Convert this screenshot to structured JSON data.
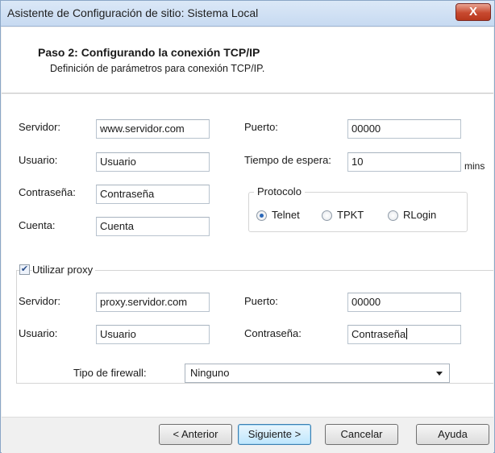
{
  "window": {
    "title": "Asistente de Configuración de sitio: Sistema Local",
    "close_label": "X"
  },
  "header": {
    "title": "Paso 2: Configurando la conexión TCP/IP",
    "subtitle": "Definición de parámetros para conexión TCP/IP."
  },
  "connection": {
    "server_label": "Servidor:",
    "server_value": "www.servidor.com",
    "user_label": "Usuario:",
    "user_value": "Usuario",
    "password_label": "Contraseña:",
    "password_value": "Contraseña",
    "account_label": "Cuenta:",
    "account_value": "Cuenta",
    "port_label": "Puerto:",
    "port_value": "00000",
    "timeout_label": "Tiempo de espera:",
    "timeout_value": "10",
    "timeout_unit": "mins"
  },
  "protocol": {
    "legend": "Protocolo",
    "options": [
      {
        "label": "Telnet",
        "selected": true
      },
      {
        "label": "TPKT",
        "selected": false
      },
      {
        "label": "RLogin",
        "selected": false
      }
    ]
  },
  "proxy": {
    "use_proxy_label": "Utilizar proxy",
    "use_proxy_checked": true,
    "server_label": "Servidor:",
    "server_value": "proxy.servidor.com",
    "user_label": "Usuario:",
    "user_value": "Usuario",
    "port_label": "Puerto:",
    "port_value": "00000",
    "password_label": "Contraseña:",
    "password_value": "Contraseña",
    "firewall_label": "Tipo de firewall:",
    "firewall_value": "Ninguno"
  },
  "footer": {
    "back_label": "< Anterior",
    "next_label": "Siguiente >",
    "cancel_label": "Cancelar",
    "help_label": "Ayuda"
  }
}
